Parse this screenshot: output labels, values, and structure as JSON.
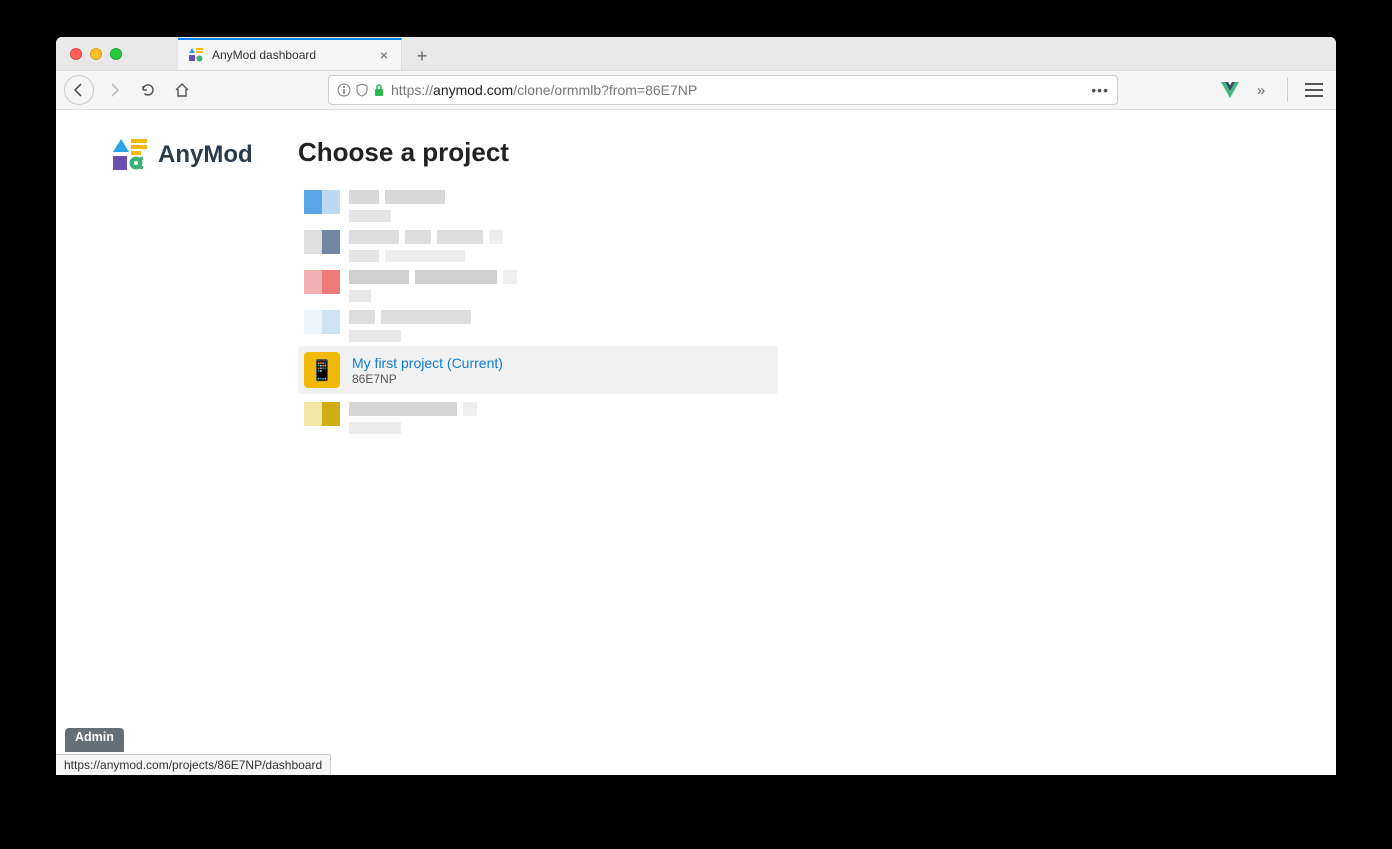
{
  "browser": {
    "tab_title": "AnyMod dashboard",
    "url_prefix": "https://",
    "url_domain": "anymod.com",
    "url_path": "/clone/ormmlb?from=86E7NP",
    "new_tab_glyph": "+",
    "close_glyph": "×",
    "meatball": "•••",
    "chevron": "»"
  },
  "page": {
    "brand": "AnyMod",
    "title": "Choose a project",
    "selected_project": {
      "name": "My first project",
      "suffix": "(Current)",
      "code": "86E7NP",
      "emoji": "📱",
      "icon_bg": "#f2b90a"
    }
  },
  "footer": {
    "admin_label": "Admin",
    "status_url": "https://anymod.com/projects/86E7NP/dashboard"
  }
}
